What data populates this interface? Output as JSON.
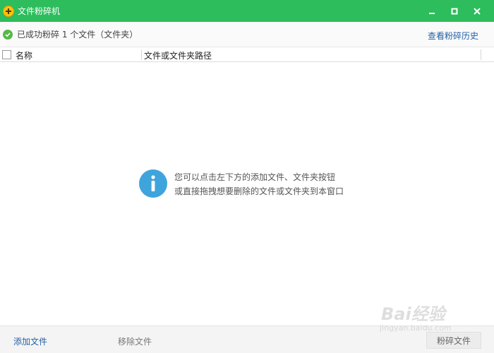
{
  "window": {
    "title": "文件粉碎机",
    "controls": [
      "minimize-icon",
      "maximize-icon",
      "close-icon"
    ]
  },
  "status": {
    "message": "已成功粉碎 1 个文件（文件夹）",
    "history_link": "查看粉碎历史"
  },
  "table": {
    "columns": [
      "名称",
      "文件或文件夹路径"
    ]
  },
  "empty_state": {
    "line1": "您可以点击左下方的添加文件、文件夹按钮",
    "line2": "或直接拖拽想要删除的文件或文件夹到本窗口"
  },
  "footer": {
    "add_label": "添加文件",
    "remove_label": "移除文件",
    "shred_label": "粉碎文件"
  },
  "watermark": {
    "logo": "Bai经验",
    "sub": "jingyan.baidu.com"
  },
  "colors": {
    "titlebar": "#2dbd5c",
    "link": "#2461a6",
    "info": "#3fa4dc",
    "success": "#55b948"
  }
}
